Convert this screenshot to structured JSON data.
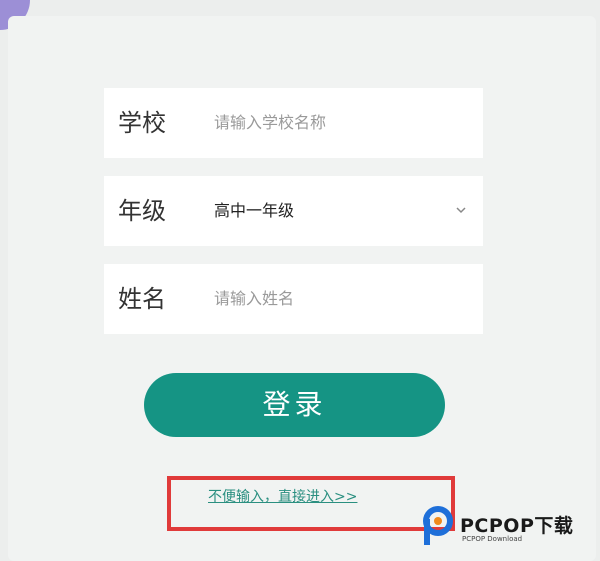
{
  "form": {
    "school": {
      "label": "学校",
      "placeholder": "请输入学校名称"
    },
    "grade": {
      "label": "年级",
      "value": "高中一年级"
    },
    "name": {
      "label": "姓名",
      "placeholder": "请输入姓名"
    },
    "login_label": "登录",
    "direct_link": "不便输入，直接进入>>"
  },
  "watermark": {
    "title": "PCPOP下载",
    "subtitle": "PCPOP Download"
  },
  "colors": {
    "accent": "#159484",
    "highlight": "#e03a3a",
    "corner": "#9c8fd6"
  }
}
